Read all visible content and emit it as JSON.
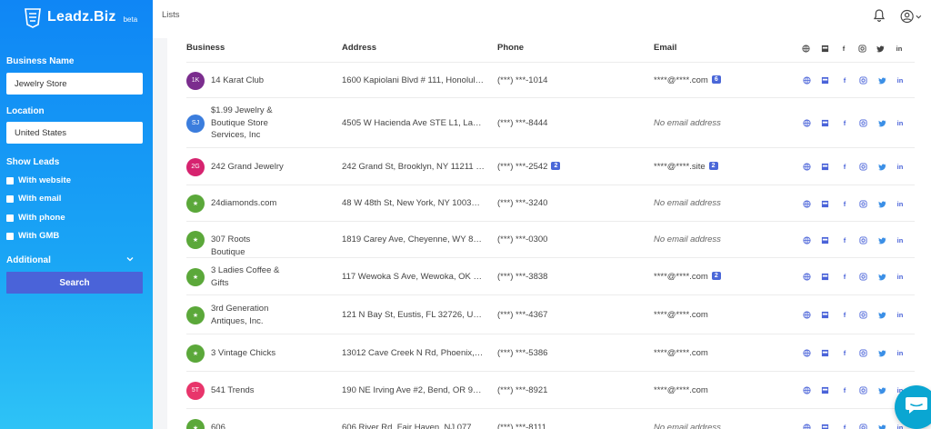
{
  "app": {
    "name": "Leadz.Biz",
    "beta": "beta"
  },
  "sidebar": {
    "business_name_label": "Business Name",
    "business_name_value": "Jewelry Store",
    "location_label": "Location",
    "location_value": "United States",
    "show_leads_label": "Show Leads",
    "filters": [
      {
        "label": "With website"
      },
      {
        "label": "With email"
      },
      {
        "label": "With phone"
      },
      {
        "label": "With GMB"
      }
    ],
    "additional_label": "Additional",
    "search_label": "Search"
  },
  "topbar": {
    "title": "Lists"
  },
  "table": {
    "headers": {
      "business": "Business",
      "address": "Address",
      "phone": "Phone",
      "email": "Email"
    },
    "rows": [
      {
        "avatar": "1K",
        "avatar_color": "#7b2d8e",
        "business": "14 Karat Club",
        "address": "1600 Kapiolani Blvd # 111, Honolulu...",
        "phone": "(***) ***-1014",
        "phone_badge": "",
        "email": "****@****.com",
        "email_badge": "6",
        "has_email": true,
        "icons": [
          "globe",
          "gmb",
          "facebook",
          "instagram",
          "twitter",
          "linkedin"
        ]
      },
      {
        "avatar": "SJ",
        "avatar_color": "#3b7ddd",
        "business": "$1.99 Jewelry & Boutique Store Services, Inc",
        "address": "4505 W Hacienda Ave STE L1, Las ...",
        "phone": "(***) ***-8444",
        "phone_badge": "",
        "email": "No email address",
        "email_badge": "",
        "has_email": false,
        "icons": [
          "globe",
          "gmb",
          "facebook",
          "instagram",
          "twitter",
          "linkedin"
        ]
      },
      {
        "avatar": "2G",
        "avatar_color": "#d6236f",
        "business": "242 Grand Jewelry",
        "address": "242 Grand St, Brooklyn, NY 11211 Uni...",
        "phone": "(***) ***-2542",
        "phone_badge": "2",
        "email": "****@****.site",
        "email_badge": "2",
        "has_email": true,
        "icons": [
          "globe",
          "gmb",
          "facebook",
          "instagram",
          "twitter",
          "linkedin"
        ]
      },
      {
        "avatar": "★",
        "avatar_color": "#5ba83a",
        "business": "24diamonds.com",
        "address": "48 W 48th St, New York, NY 10036, ...",
        "phone": "(***) ***-3240",
        "phone_badge": "",
        "email": "No email address",
        "email_badge": "",
        "has_email": false,
        "icons": [
          "globe",
          "gmb",
          "facebook",
          "instagram",
          "twitter",
          "linkedin"
        ]
      },
      {
        "avatar": "★",
        "avatar_color": "#5ba83a",
        "business": "307 Roots Boutique",
        "address": "1819 Carey Ave, Cheyenne, WY 82...",
        "phone": "(***) ***-0300",
        "phone_badge": "",
        "email": "No email address",
        "email_badge": "",
        "has_email": false,
        "icons": [
          "globe",
          "gmb",
          "facebook",
          "instagram",
          "twitter",
          "linkedin"
        ]
      },
      {
        "avatar": "★",
        "avatar_color": "#5ba83a",
        "business": "3 Ladies Coffee & Gifts",
        "address": "117 Wewoka S Ave, Wewoka, OK 74...",
        "phone": "(***) ***-3838",
        "phone_badge": "",
        "email": "****@****.com",
        "email_badge": "2",
        "has_email": true,
        "icons": [
          "globe",
          "gmb",
          "facebook",
          "instagram",
          "twitter",
          "linkedin"
        ]
      },
      {
        "avatar": "★",
        "avatar_color": "#5ba83a",
        "business": "3rd Generation Antiques, Inc.",
        "address": "121 N Bay St, Eustis, FL 32726, Unite...",
        "phone": "(***) ***-4367",
        "phone_badge": "",
        "email": "****@****.com",
        "email_badge": "",
        "has_email": true,
        "icons": [
          "globe",
          "gmb",
          "facebook",
          "instagram",
          "twitter",
          "linkedin"
        ]
      },
      {
        "avatar": "★",
        "avatar_color": "#5ba83a",
        "business": "3 Vintage Chicks",
        "address": "13012 Cave Creek N Rd, Phoenix, A...",
        "phone": "(***) ***-5386",
        "phone_badge": "",
        "email": "****@****.com",
        "email_badge": "",
        "has_email": true,
        "icons": [
          "globe",
          "gmb",
          "facebook",
          "instagram",
          "twitter",
          "linkedin"
        ]
      },
      {
        "avatar": "5T",
        "avatar_color": "#e8356b",
        "business": "541 Trends",
        "address": "190 NE Irving Ave #2, Bend, OR 977...",
        "phone": "(***) ***-8921",
        "phone_badge": "",
        "email": "****@****.com",
        "email_badge": "",
        "has_email": true,
        "icons": [
          "globe",
          "gmb",
          "facebook",
          "instagram",
          "twitter",
          "linkedin"
        ]
      },
      {
        "avatar": "★",
        "avatar_color": "#5ba83a",
        "business": "606",
        "address": "606 River Rd, Fair Haven, NJ 07704...",
        "phone": "(***) ***-8111",
        "phone_badge": "",
        "email": "No email address",
        "email_badge": "",
        "has_email": false,
        "icons": [
          "globe",
          "gmb",
          "facebook",
          "instagram",
          "twitter",
          "linkedin"
        ]
      }
    ]
  },
  "colors": {
    "accent": "#4a63d9",
    "sidebar_top": "#0f86f5",
    "sidebar_bottom": "#2ec3f6",
    "chat": "#0aa6d2"
  }
}
